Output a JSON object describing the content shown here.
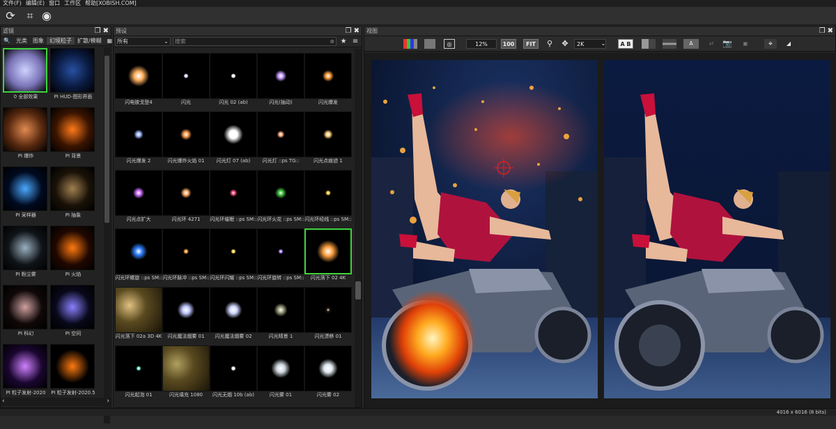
{
  "menu": [
    "文件(F)",
    "编辑(E)",
    "窗口",
    "工作区",
    "帮助[XOBISH.COM]"
  ],
  "filters_panel": {
    "title": "滤镜",
    "tabs": [
      "光类",
      "图象",
      "幻境粒子",
      "扩散/模糊"
    ],
    "items": [
      {
        "label": "0 全部效果",
        "swatch": "#7b74b8",
        "glow": "#cdd2ff",
        "selected": true
      },
      {
        "label": "PI HUD-图形界面",
        "swatch": "#0a1a40",
        "glow": "#2850a0"
      },
      {
        "label": "PI 爆炸",
        "swatch": "#5a2a10",
        "glow": "#e08a50"
      },
      {
        "label": "PI 背景",
        "swatch": "#3a1400",
        "glow": "#ff7a1a"
      },
      {
        "label": "PI 采样器",
        "swatch": "#000a20",
        "glow": "#4aa8ff"
      },
      {
        "label": "PI 抽象",
        "swatch": "#1a1208",
        "glow": "#a08050"
      },
      {
        "label": "PI 粉尘雾",
        "swatch": "#101418",
        "glow": "#9ab0c0"
      },
      {
        "label": "PI 火焰",
        "swatch": "#200800",
        "glow": "#ff7a10"
      },
      {
        "label": "PI 科幻",
        "swatch": "#100808",
        "glow": "#d0a0a0"
      },
      {
        "label": "PI 空间",
        "swatch": "#08081a",
        "glow": "#8a80ff"
      },
      {
        "label": "PI 粒子发射-2020",
        "swatch": "#1a0630",
        "glow": "#d080ff"
      },
      {
        "label": "PI 粒子发射-2020.5",
        "swatch": "#000000",
        "glow": "#ff7a10"
      }
    ]
  },
  "presets_panel": {
    "title": "预设",
    "category": "所有",
    "search_placeholder": "搜索",
    "items": [
      {
        "label": "闪电彼戈登4",
        "glow": "#ffb060",
        "size": 0.55
      },
      {
        "label": "闪光",
        "glow": "#e8d8ff",
        "size": 0.12
      },
      {
        "label": "闪光 02 (ab)",
        "glow": "#ffffff",
        "size": 0.08
      },
      {
        "label": "闪光(抽动)",
        "glow": "#c8a0ff",
        "size": 0.3
      },
      {
        "label": "闪光爆发",
        "glow": "#ffa040",
        "size": 0.3
      },
      {
        "label": "闪光爆发 2",
        "glow": "#a0b8ff",
        "size": 0.25
      },
      {
        "label": "闪光爆炸火焰 01",
        "glow": "#ffa050",
        "size": 0.3
      },
      {
        "label": "闪光灯 07 (ab)",
        "glow": "#ffffff",
        "size": 0.5
      },
      {
        "label": "闪光灯 ::ps TG::",
        "glow": "#ffb080",
        "size": 0.2
      },
      {
        "label": "闪光点痕迹 1",
        "glow": "#ffd080",
        "size": 0.25
      },
      {
        "label": "闪光点扩大",
        "glow": "#d070ff",
        "size": 0.3
      },
      {
        "label": "闪光环 4271",
        "glow": "#ffb070",
        "size": 0.28
      },
      {
        "label": "闪光环催眠 ::ps SM::",
        "glow": "#ff5080",
        "size": 0.2
      },
      {
        "label": "闪光环火花 ::ps SM::",
        "glow": "#40c040",
        "size": 0.3
      },
      {
        "label": "闪光环经线 ::ps SM::",
        "glow": "#ffd040",
        "size": 0.15
      },
      {
        "label": "闪光环螺旋 ::ps SM::",
        "glow": "#3080ff",
        "size": 0.45
      },
      {
        "label": "闪光环脉冲 ::ps SM::",
        "glow": "#ffa040",
        "size": 0.15
      },
      {
        "label": "闪光环闪耀 ::ps SM::",
        "glow": "#ffe060",
        "size": 0.1
      },
      {
        "label": "闪光环旋转 ::ps SM::",
        "glow": "#b080ff",
        "size": 0.12
      },
      {
        "label": "闪光落下 02 4K",
        "glow": "#ffa040",
        "size": 0.6,
        "selected": true
      },
      {
        "label": "闪光落下 02a 3D 4K",
        "glow": "#e0c080",
        "size": 0.9
      },
      {
        "label": "闪光魔法烟雾 01",
        "glow": "#c0c8ff",
        "size": 0.45
      },
      {
        "label": "闪光魔法烟雾 02",
        "glow": "#d0d8ff",
        "size": 0.45
      },
      {
        "label": "闪光晴景 1",
        "glow": "#a0a080",
        "size": 0.35
      },
      {
        "label": "闪光漂移 01",
        "glow": "#201810",
        "size": 0.2
      },
      {
        "label": "闪光起泡 01",
        "glow": "#60ffe0",
        "size": 0.1
      },
      {
        "label": "闪光填充 1080",
        "glow": "#b0a060",
        "size": 1.0
      },
      {
        "label": "闪光无烟 10b (ab)",
        "glow": "#ffffff",
        "size": 0.05
      },
      {
        "label": "闪光雾 01",
        "glow": "#d0d8e0",
        "size": 0.5
      },
      {
        "label": "闪光雾 02",
        "glow": "#e0e8f0",
        "size": 0.5
      }
    ]
  },
  "view_panel": {
    "title": "视图",
    "zoom": "12%",
    "zoom_fit": "100",
    "fit_label": "FIT",
    "preview_size": "2K",
    "ab_label": "A B",
    "a_label": "A"
  },
  "status": {
    "image_info": "4016 x 6016 (8 bits)"
  },
  "colors": {
    "selection": "#3ed43e",
    "panel_bg": "#222222",
    "header_bg": "#2f2f2f"
  }
}
